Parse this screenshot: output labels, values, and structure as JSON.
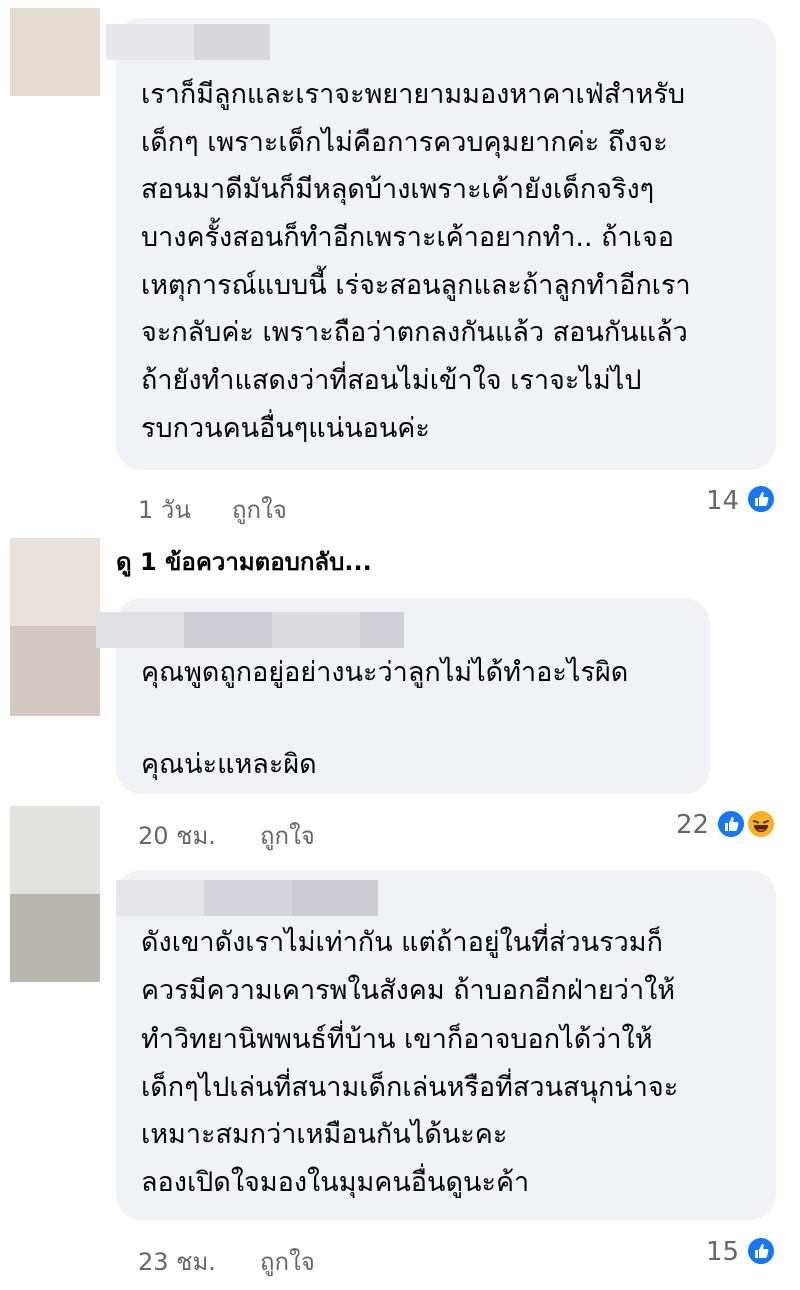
{
  "comments": [
    {
      "lines": [
        "เราก็มีลูกและเราจะพยายามมองหาคาเฟ่สำหรับ",
        "เด็กๆ เพราะเด็กไม่คือการควบคุมยากค่ะ ถึงจะ",
        "สอนมาดีมันก็มีหลุดบ้างเพราะเค้ายังเด็กจริงๆ",
        "บางครั้งสอนก็ทำอีกเพราะเค้าอยากทำ.. ถ้าเจอ",
        "เหตุการณ์แบบนี้ เร่จะสอนลูกและถ้าลูกทำอีกเรา",
        "จะกลับค่ะ เพราะถือว่าตกลงกันแล้ว สอนกันแล้ว",
        "ถ้ายังทำแสดงว่าที่สอนไม่เข้าใจ เราจะไม่ไป",
        "รบกวนคนอื่นๆแน่นอนค่ะ"
      ],
      "time": "1 วัน",
      "like_label": "ถูกใจ",
      "reaction_count": "14"
    },
    {
      "lines": [
        "คุณพูดถูกอยู่อย่างนะว่าลูกไม่ได้ทำอะไรผิด",
        "",
        "คุณน่ะแหละผิด"
      ],
      "time": "20 ชม.",
      "like_label": "ถูกใจ",
      "reaction_count": "22"
    },
    {
      "lines": [
        "ดังเขาดังเราไม่เท่ากัน แต่ถ้าอยู่ในที่ส่วนรวมก็",
        "ควรมีความเคารพในสังคม ถ้าบอกอีกฝ่ายว่าให้",
        "ทำวิทยานิพพนธ์ที่บ้าน เขาก็อาจบอกได้ว่าให้",
        "เด็กๆไปเล่นที่สนามเด็กเล่นหรือที่สวนสนุกน่าจะ",
        "เหมาะสมกว่าเหมือนกันได้นะคะ",
        "ลองเปิดใจมองในมุมคนอื่นดูนะค้า"
      ],
      "time": "23 ชม.",
      "like_label": "ถูกใจ",
      "reaction_count": "15"
    }
  ],
  "view_replies": "ดู 1 ข้อความตอบกลับ...",
  "icons": {
    "like": "like-reaction-icon",
    "haha": "haha-reaction-icon"
  },
  "colors": {
    "like_blue": "#1877f2",
    "bubble_bg": "#f0f2f5",
    "meta_gray": "#65676b"
  }
}
